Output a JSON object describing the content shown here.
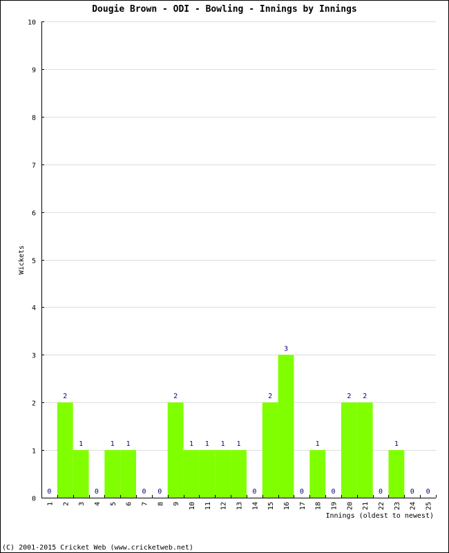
{
  "chart_data": {
    "type": "bar",
    "title": "Dougie Brown - ODI - Bowling - Innings by Innings",
    "xlabel": "Innings (oldest to newest)",
    "ylabel": "Wickets",
    "ylim": [
      0,
      10
    ],
    "yticks": [
      0,
      1,
      2,
      3,
      4,
      5,
      6,
      7,
      8,
      9,
      10
    ],
    "grid": true,
    "categories": [
      "1",
      "2",
      "3",
      "4",
      "5",
      "6",
      "7",
      "8",
      "9",
      "10",
      "11",
      "12",
      "13",
      "14",
      "15",
      "16",
      "17",
      "18",
      "19",
      "20",
      "21",
      "22",
      "23",
      "24",
      "25"
    ],
    "values": [
      0,
      2,
      1,
      0,
      1,
      1,
      0,
      0,
      2,
      1,
      1,
      1,
      1,
      0,
      2,
      3,
      0,
      1,
      0,
      2,
      2,
      0,
      1,
      0,
      0
    ],
    "bar_color": "#80ff00",
    "label_color": "#000080",
    "grid_color": "#dddddd"
  },
  "footer": {
    "copyright": "(C) 2001-2015 Cricket Web (www.cricketweb.net)"
  }
}
